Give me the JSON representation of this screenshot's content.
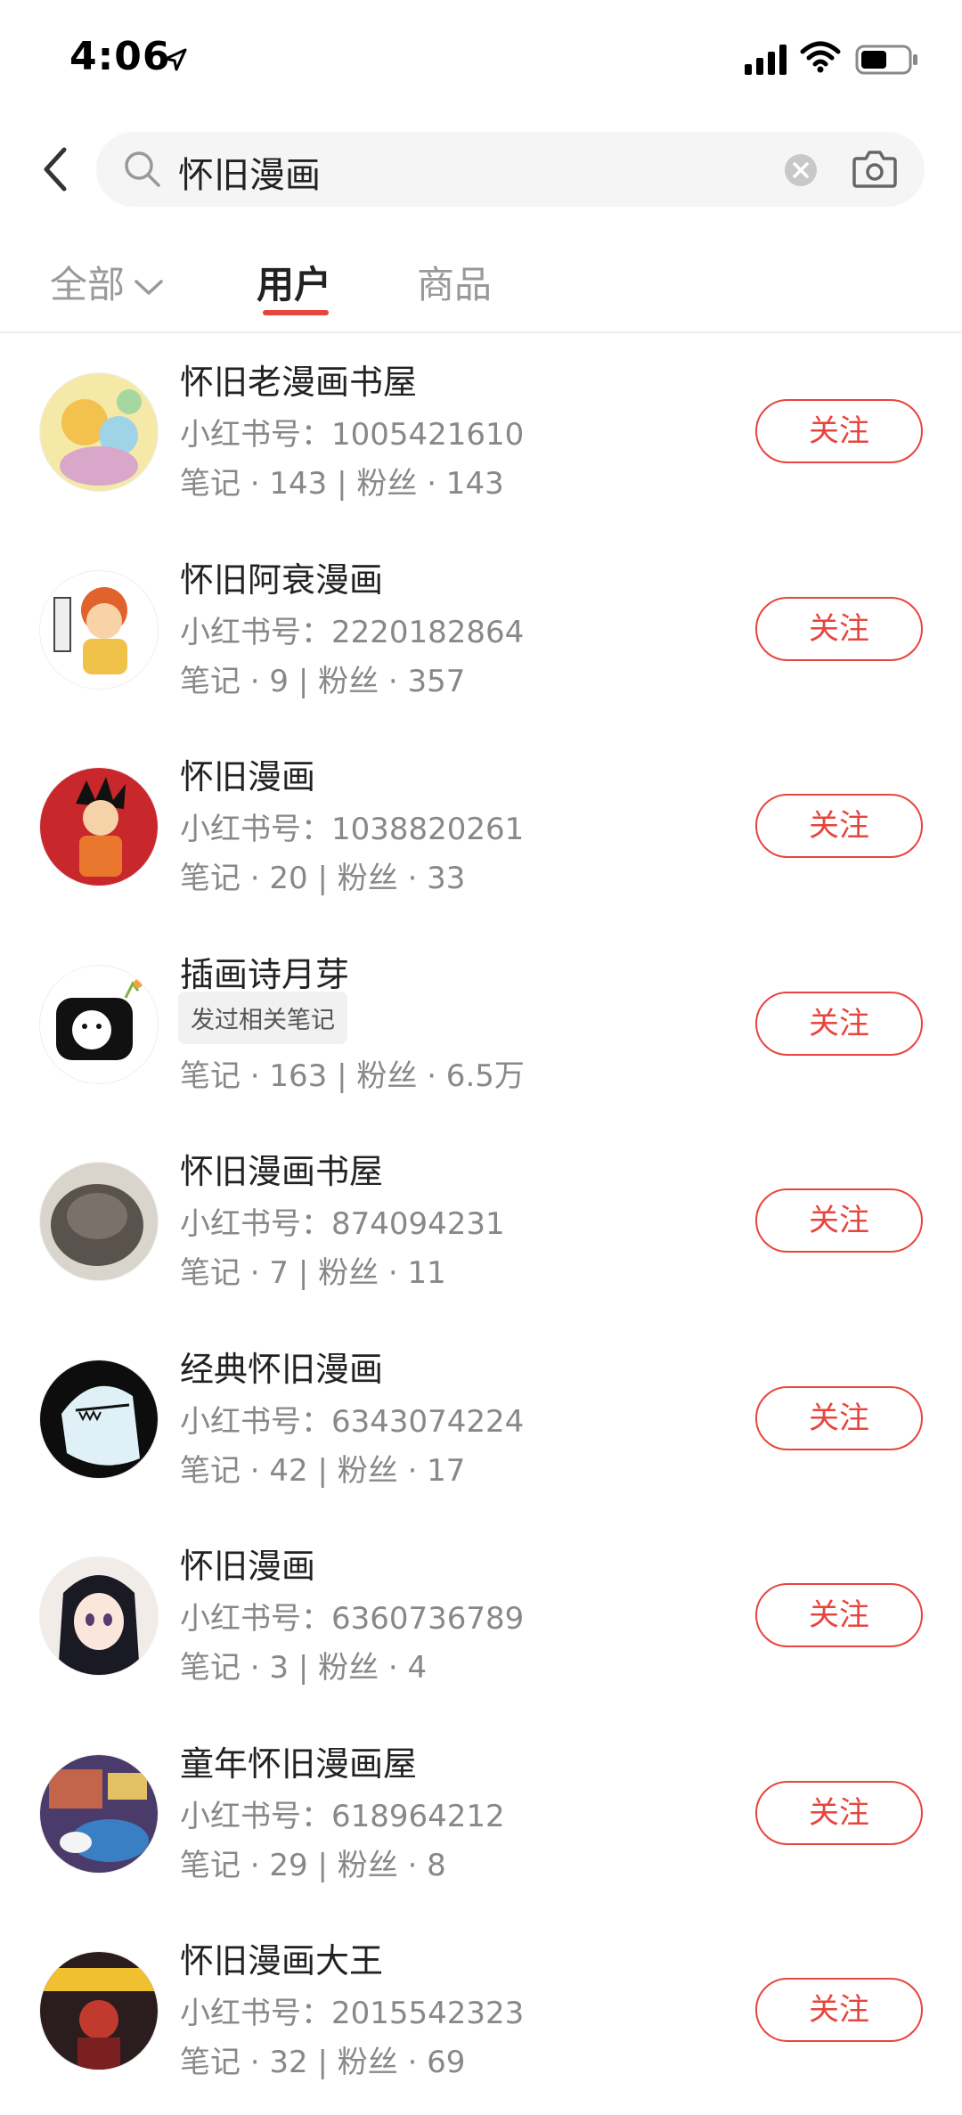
{
  "status_bar": {
    "time": "4:06"
  },
  "search": {
    "query": "怀旧漫画"
  },
  "tabs": {
    "all": "全部",
    "users": "用户",
    "goods": "商品"
  },
  "follow_label": "关注",
  "users": [
    {
      "name": "怀旧老漫画书屋",
      "id_line": "小红书号：1005421610",
      "stats": "笔记 · 143 | 粉丝 · 143",
      "badge": null,
      "avatar_color": "#e6d37a"
    },
    {
      "name": "怀旧阿衰漫画",
      "id_line": "小红书号：2220182864",
      "stats": "笔记 · 9 | 粉丝 · 357",
      "badge": null,
      "avatar_color": "#f2a25a"
    },
    {
      "name": "怀旧漫画",
      "id_line": "小红书号：1038820261",
      "stats": "笔记 · 20 | 粉丝 · 33",
      "badge": null,
      "avatar_color": "#c8282c"
    },
    {
      "name": "插画诗月芽",
      "id_line": "",
      "stats": "笔记 · 163 | 粉丝 · 6.5万",
      "badge": "发过相关笔记",
      "avatar_color": "#111111"
    },
    {
      "name": "怀旧漫画书屋",
      "id_line": "小红书号：874094231",
      "stats": "笔记 · 7 | 粉丝 · 11",
      "badge": null,
      "avatar_color": "#6e6660"
    },
    {
      "name": "经典怀旧漫画",
      "id_line": "小红书号：6343074224",
      "stats": "笔记 · 42 | 粉丝 · 17",
      "badge": null,
      "avatar_color": "#0d0d0d"
    },
    {
      "name": "怀旧漫画",
      "id_line": "小红书号：6360736789",
      "stats": "笔记 · 3 | 粉丝 · 4",
      "badge": null,
      "avatar_color": "#d9c9c0"
    },
    {
      "name": "童年怀旧漫画屋",
      "id_line": "小红书号：618964212",
      "stats": "笔记 · 29 | 粉丝 · 8",
      "badge": null,
      "avatar_color": "#3a7fc4"
    },
    {
      "name": "怀旧漫画大王",
      "id_line": "小红书号：2015542323",
      "stats": "笔记 · 32 | 粉丝 · 69",
      "badge": null,
      "avatar_color": "#7a2020"
    }
  ]
}
